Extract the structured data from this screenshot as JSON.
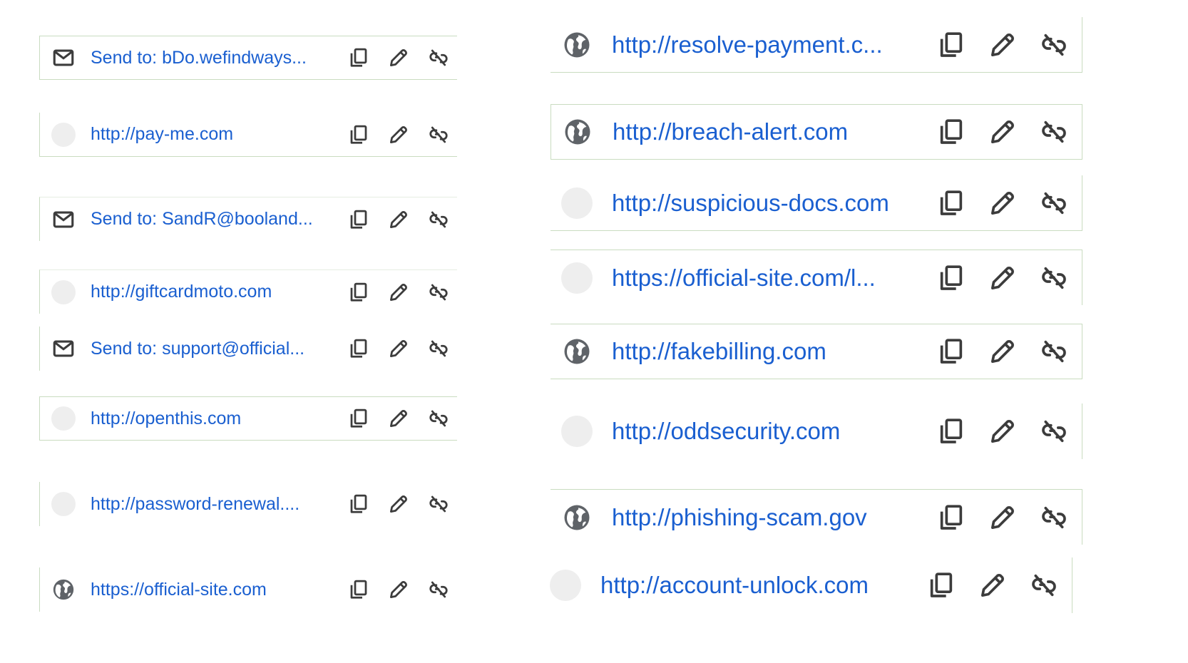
{
  "colors": {
    "link": "#1a5fd0",
    "icon": "#3c3c3c",
    "border": "#c9dcc0",
    "placeholder": "#eeeeee"
  },
  "icons": {
    "copy": "copy-icon",
    "edit": "pencil-icon",
    "unlink": "unlink-icon",
    "email": "mail-icon",
    "web": "globe-icon"
  },
  "left_chips": [
    {
      "lead": "mail",
      "text": "Send to: bDo.wefindways..."
    },
    {
      "lead": "blank",
      "text": "http://pay-me.com"
    },
    {
      "lead": "mail",
      "text": "Send to: SandR@booland..."
    },
    {
      "lead": "blank",
      "text": "http://giftcardmoto.com"
    },
    {
      "lead": "mail",
      "text": "Send to: support@official..."
    },
    {
      "lead": "blank",
      "text": "http://openthis.com"
    },
    {
      "lead": "blank",
      "text": "http://password-renewal...."
    },
    {
      "lead": "globe",
      "text": "https://official-site.com"
    }
  ],
  "right_chips": [
    {
      "lead": "globe",
      "text": "http://resolve-payment.c..."
    },
    {
      "lead": "globe",
      "text": "http://breach-alert.com"
    },
    {
      "lead": "blank",
      "text": "http://suspicious-docs.com"
    },
    {
      "lead": "blank",
      "text": "https://official-site.com/l..."
    },
    {
      "lead": "globe",
      "text": "http://fakebilling.com"
    },
    {
      "lead": "blank",
      "text": "http://oddsecurity.com"
    },
    {
      "lead": "globe",
      "text": "http://phishing-scam.gov"
    },
    {
      "lead": "blank",
      "text": "http://account-unlock.com"
    }
  ]
}
